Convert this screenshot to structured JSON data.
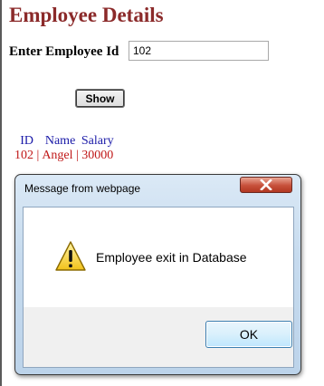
{
  "page": {
    "title": "Employee Details",
    "id_label": "Enter Employee Id",
    "id_value": "102",
    "show_label": "Show"
  },
  "results": {
    "headers": [
      "ID",
      "Name",
      "Salary"
    ],
    "row": [
      "102 |",
      "Angel |",
      "30000"
    ]
  },
  "dialog": {
    "title": "Message from webpage",
    "message": "Employee exit in Database",
    "ok_label": "OK",
    "icon": "warning-icon",
    "close_icon": "close-icon"
  },
  "colors": {
    "title": "#8b2a2a",
    "header_text": "#1a1aa8",
    "cell_text": "#c01818",
    "close_button": "#c7503a"
  }
}
